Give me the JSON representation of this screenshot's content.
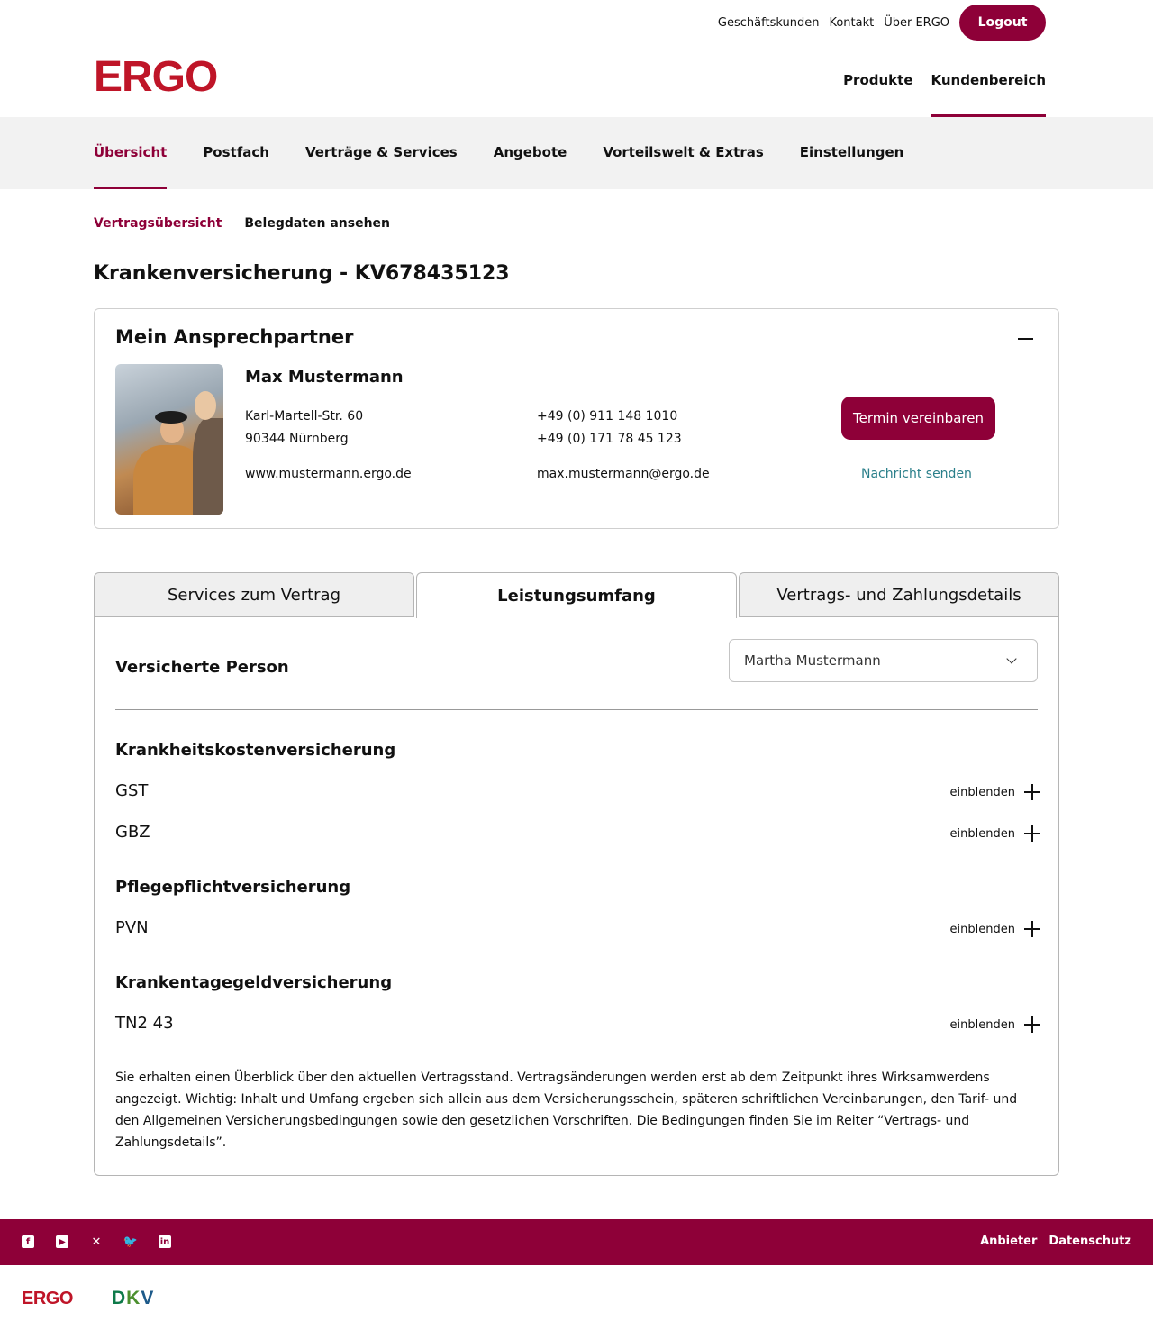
{
  "header": {
    "top_links": [
      "Geschäftskunden",
      "Kontakt",
      "Über ERGO"
    ],
    "logout_label": "Logout",
    "logo": "ERGO",
    "main_nav": [
      {
        "label": "Produkte",
        "active": false
      },
      {
        "label": "Kundenbereich",
        "active": true
      }
    ]
  },
  "subnav": {
    "items": [
      "Übersicht",
      "Postfach",
      "Verträge & Services",
      "Angebote",
      "Vorteilswelt & Extras",
      "Einstellungen"
    ],
    "active_index": 0
  },
  "tertiary_nav": {
    "items": [
      "Vertragsübersicht",
      "Belegdaten ansehen"
    ],
    "active_index": 0
  },
  "page_title": "Krankenversicherung - KV678435123",
  "contact_card": {
    "title": "Mein Ansprechpartner",
    "name": "Max Mustermann",
    "address_line1": "Karl-Martell-Str. 60",
    "address_line2": "90344 Nürnberg",
    "phone1": "+49 (0) 911 148 1010",
    "phone2": "+49 (0) 171 78 45 123",
    "website": "www.mustermann.ergo.de",
    "email": "max.mustermann@ergo.de",
    "appointment_button": "Termin vereinbaren",
    "message_link": "Nachricht senden"
  },
  "tabs": [
    {
      "label": "Services zum Vertrag",
      "active": false
    },
    {
      "label": "Leistungsumfang",
      "active": true
    },
    {
      "label": "Vertrags- und Zahlungsdetails",
      "active": false
    }
  ],
  "leistungsumfang": {
    "insured_person_label": "Versicherte Person",
    "insured_person_selected": "Martha Mustermann",
    "expand_label": "einblenden",
    "sections": [
      {
        "title": "Krankheitskostenversicherung",
        "rows": [
          "GST",
          "GBZ"
        ]
      },
      {
        "title": "Pflegepflichtversicherung",
        "rows": [
          "PVN"
        ]
      },
      {
        "title": "Krankentagegeldversicherung",
        "rows": [
          "TN2 43"
        ]
      }
    ],
    "disclaimer": "Sie erhalten einen Überblick über den aktuellen Vertragsstand. Vertragsänderungen werden erst ab dem Zeitpunkt ihres Wirksamwerdens angezeigt. Wichtig: Inhalt und Umfang ergeben sich allein aus dem Versicherungsschein, späteren schriftlichen Vereinbarungen, den Tarif- und den Allgemeinen Versicherungsbedingungen sowie den gesetzlichen Vorschriften. Die Bedingungen finden Sie im Reiter “Vertrags- und Zahlungsdetails”."
  },
  "footer": {
    "social_icons": [
      "facebook-icon",
      "youtube-icon",
      "xing-icon",
      "twitter-icon",
      "linkedin-icon"
    ],
    "links": [
      "Anbieter",
      "Datenschutz"
    ],
    "brand_ergo": "ERGO",
    "brand_dkv": "DKV"
  },
  "colors": {
    "brand_primary": "#8e0038",
    "logo_red": "#bf1528",
    "link_teal": "#2a7f8a",
    "subnav_bg": "#f2f2f2"
  }
}
